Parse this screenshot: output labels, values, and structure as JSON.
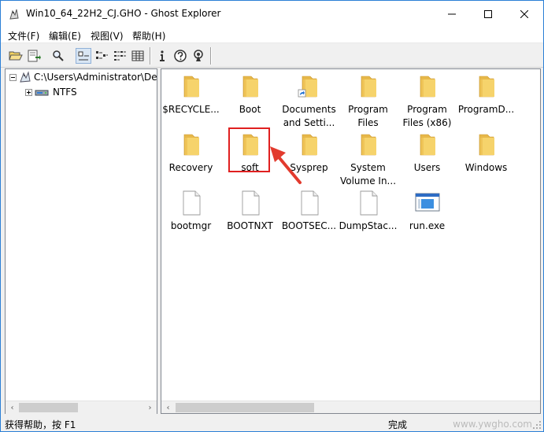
{
  "window": {
    "title": "Win10_64_22H2_CJ.GHO - Ghost Explorer",
    "controls": {
      "minimize_icon": "minimize-icon",
      "maximize_icon": "maximize-icon",
      "close_icon": "close-icon"
    }
  },
  "menu": {
    "items": [
      {
        "label": "文件(F)"
      },
      {
        "label": "编辑(E)"
      },
      {
        "label": "视图(V)"
      },
      {
        "label": "帮助(H)"
      }
    ]
  },
  "toolbar": {
    "buttons": [
      {
        "icon": "open-folder-icon"
      },
      {
        "icon": "extract-icon"
      },
      {
        "icon": "find-icon"
      },
      {
        "icon": "large-icons-view-icon",
        "pressed": true
      },
      {
        "icon": "small-icons-view-icon"
      },
      {
        "icon": "list-view-icon"
      },
      {
        "icon": "details-view-icon"
      },
      {
        "icon": "info-icon"
      },
      {
        "icon": "help-icon"
      },
      {
        "icon": "span-icon"
      }
    ]
  },
  "tree": {
    "root_label": "C:\\Users\\Administrator\\De",
    "child_label": "NTFS"
  },
  "files": [
    {
      "label": "$RECYCLE...",
      "type": "folder"
    },
    {
      "label": "Boot",
      "type": "folder"
    },
    {
      "label": "Documents and Setti...",
      "type": "folder-shortcut"
    },
    {
      "label": "Program Files",
      "type": "folder"
    },
    {
      "label": "Program Files (x86)",
      "type": "folder"
    },
    {
      "label": "ProgramD...",
      "type": "folder"
    },
    {
      "label": "Recovery",
      "type": "folder"
    },
    {
      "label": "soft",
      "type": "folder",
      "highlighted": true
    },
    {
      "label": "Sysprep",
      "type": "folder"
    },
    {
      "label": "System Volume In...",
      "type": "folder"
    },
    {
      "label": "Users",
      "type": "folder"
    },
    {
      "label": "Windows",
      "type": "folder"
    },
    {
      "label": "bootmgr",
      "type": "file"
    },
    {
      "label": "BOOTNXT",
      "type": "file"
    },
    {
      "label": "BOOTSEC...",
      "type": "file"
    },
    {
      "label": "DumpStac...",
      "type": "file"
    },
    {
      "label": "run.exe",
      "type": "exe"
    }
  ],
  "status": {
    "left": "获得帮助，按 F1",
    "right": "完成",
    "watermark": "www.ywgho.com"
  },
  "colors": {
    "folder": "#f6d36b",
    "highlight": "#e02020",
    "arrow": "#e23b2e",
    "selection": "#d9e6f4"
  }
}
